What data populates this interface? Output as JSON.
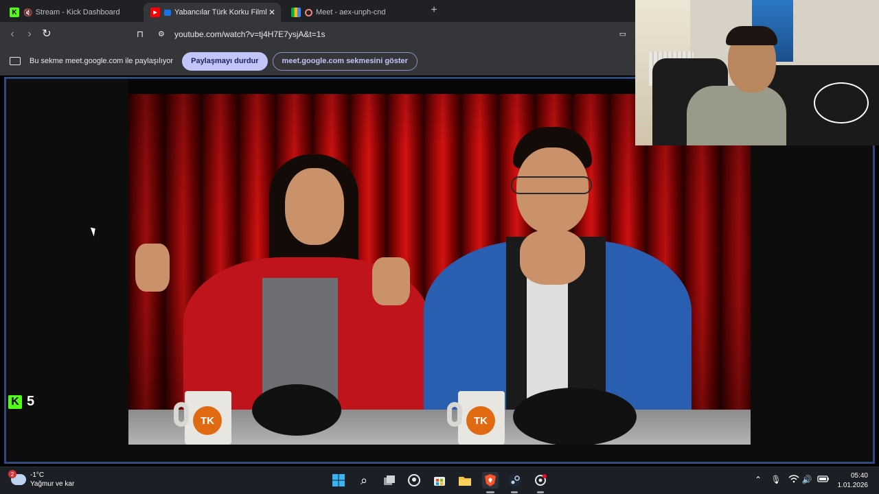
{
  "browser": {
    "tabs": [
      {
        "label": "Stream - Kick Dashboard",
        "icon": "kick-icon",
        "active": false
      },
      {
        "label": "Yabancılar Türk Korku Filmleri",
        "icon": "youtube-icon",
        "active": true
      },
      {
        "label": "Meet - aex-unph-cnd",
        "icon": "google-meet-icon",
        "active": false
      }
    ],
    "url": "youtube.com/watch?v=tj4H7E7ysjA&t=1s"
  },
  "sharing_bar": {
    "message": "Bu sekme meet.google.com ile paylaşılıyor",
    "stop_button": "Paylaşmayı durdur",
    "show_tab_button": "meet.google.com sekmesini göster"
  },
  "overlay": {
    "viewer_count": "5",
    "kick_color": "#53fc18"
  },
  "video": {
    "mug_logo": "TK"
  },
  "taskbar": {
    "weather_badge": "2",
    "temperature": "-1°C",
    "condition": "Yağmur ve kar",
    "time": "05:40",
    "date": "1.01.2026",
    "apps": [
      "windows-start-icon",
      "search-icon",
      "task-view-icon",
      "copilot-icon",
      "store-icon",
      "file-explorer-icon",
      "brave-icon",
      "steam-icon",
      "settings-icon"
    ]
  },
  "colors": {
    "tab_bar": "#202124",
    "toolbar": "#35363a",
    "share_frame": "#2f4a7c",
    "stop_button": "#c2c5f7"
  }
}
